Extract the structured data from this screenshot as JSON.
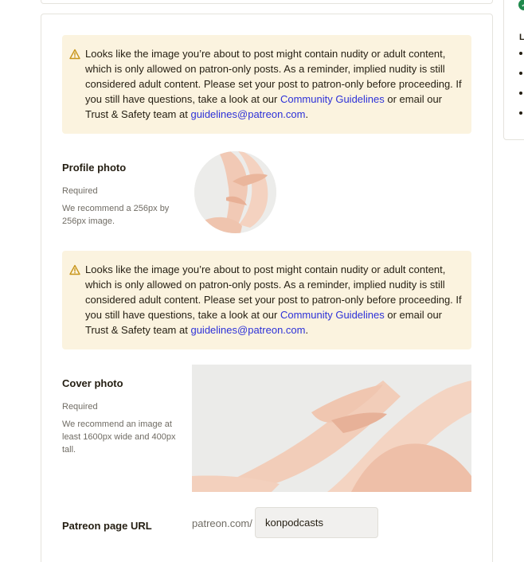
{
  "warnings": {
    "message_before_link": "Looks like the image you’re about to post might contain nudity or adult content, which is only allowed on patron-only posts. As a reminder, implied nudity is still considered adult content. Please set your post to patron-only before proceeding. If you still have questions, take a look at our ",
    "guidelines_link": "Community Guidelines",
    "message_middle": " or email our Trust & Safety team at ",
    "email_link": "guidelines@patreon.com",
    "message_end": "."
  },
  "profile_photo": {
    "title": "Profile photo",
    "required": "Required",
    "hint": "We recommend a 256px by 256px image."
  },
  "cover_photo": {
    "title": "Cover photo",
    "required": "Required",
    "hint": "We recommend an image at least 1600px wide and 400px tall."
  },
  "page_url": {
    "title": "Patreon page URL",
    "prefix": "patreon.com/",
    "value": "konpodcasts"
  },
  "right_panel": {
    "heading": "L"
  },
  "colors": {
    "warning_bg": "#fbf3df",
    "link": "#2d31d8",
    "success": "#1f8a4c"
  }
}
